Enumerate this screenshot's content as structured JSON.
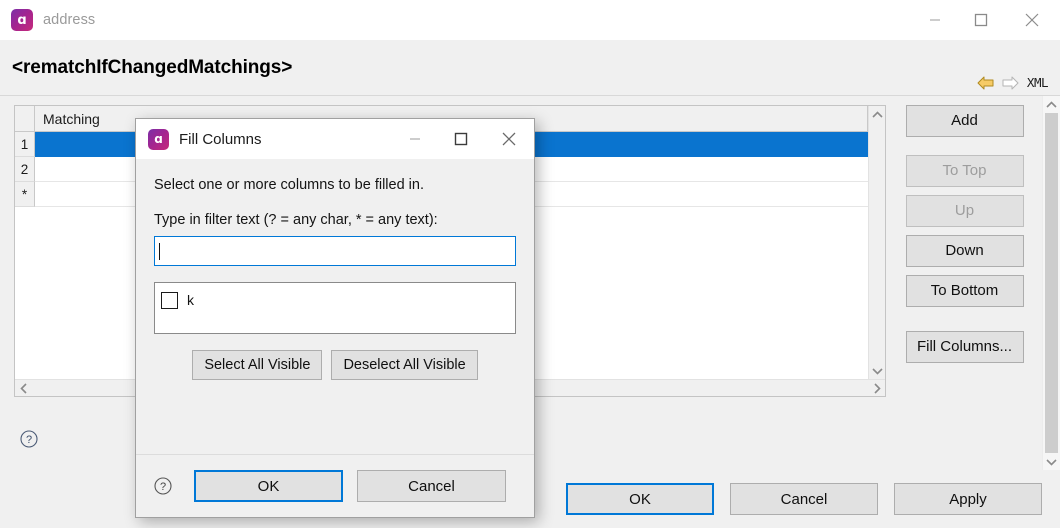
{
  "window": {
    "title": "address",
    "icon": "app-alpha-icon",
    "controls": {
      "minimize": "minimize-icon",
      "maximize": "maximize-icon",
      "close": "close-icon"
    }
  },
  "header": {
    "title": "<rematchIfChangedMatchings>",
    "back_icon": "back-arrow-icon",
    "forward_icon": "forward-arrow-icon",
    "xml_label": "XML"
  },
  "table": {
    "columns": [
      "Matching"
    ],
    "row_headers": [
      "1",
      "2",
      "*"
    ],
    "rows": [
      {
        "header": "1",
        "matching": "",
        "selected": true
      },
      {
        "header": "2",
        "matching": "",
        "selected": false
      },
      {
        "header": "*",
        "matching": "",
        "selected": false
      }
    ],
    "selection_color": "#0a74cf"
  },
  "side_buttons": [
    {
      "label": "Add",
      "enabled": true
    },
    {
      "label": "To Top",
      "enabled": false
    },
    {
      "label": "Up",
      "enabled": false
    },
    {
      "label": "Down",
      "enabled": true
    },
    {
      "label": "To Bottom",
      "enabled": true
    },
    {
      "label": "Fill Columns...",
      "enabled": true
    }
  ],
  "footer": {
    "help_icon": "help-circle-icon",
    "ok_label": "OK",
    "cancel_label": "Cancel",
    "apply_label": "Apply"
  },
  "dialog": {
    "title": "Fill Columns",
    "icon": "app-alpha-icon",
    "controls": {
      "minimize": "minimize-icon",
      "maximize": "maximize-icon",
      "close": "close-icon"
    },
    "instruction": "Select one or more columns to be filled in.",
    "filter_prompt": "Type in filter text (? = any char, * = any text):",
    "filter_value": "",
    "filter_placeholder": "",
    "list_items": [
      {
        "label": "k",
        "checked": false
      }
    ],
    "select_all_label": "Select All Visible",
    "deselect_all_label": "Deselect All Visible",
    "help_icon": "help-circle-icon",
    "ok_label": "OK",
    "cancel_label": "Cancel",
    "focus_color": "#0078d7"
  }
}
